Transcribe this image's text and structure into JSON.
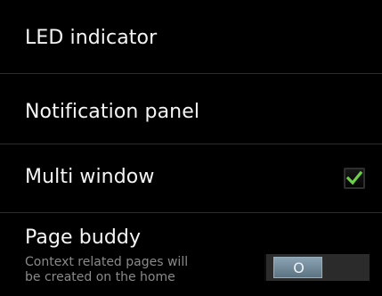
{
  "settings": {
    "items": [
      {
        "label": "LED indicator"
      },
      {
        "label": "Notification panel"
      },
      {
        "label": "Multi window",
        "checked": true
      },
      {
        "label": "Page buddy",
        "description_line1": "Context related pages will",
        "description_line2": "be created on the home",
        "toggle_state": "O"
      }
    ],
    "colors": {
      "background": "#000000",
      "divider": "#2b2b2b",
      "checkmark": "#6ed04a",
      "toggle_knob": "#7b93a3"
    }
  }
}
